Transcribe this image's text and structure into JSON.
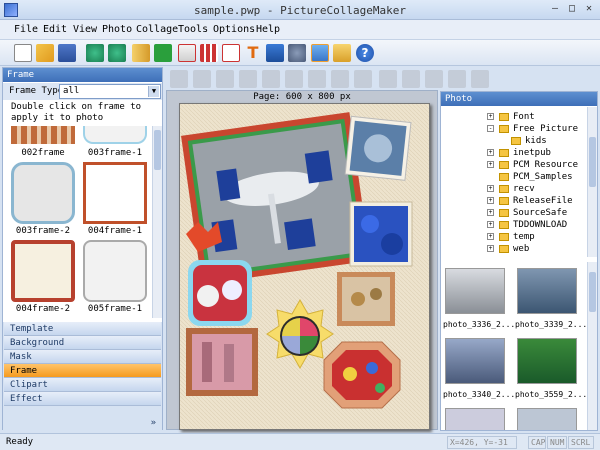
{
  "window": {
    "title": "sample.pwp - PictureCollageMaker"
  },
  "menu": [
    "File",
    "Edit",
    "View",
    "Photo",
    "Collage",
    "Tools",
    "Options",
    "Help"
  ],
  "toolbar_icons": [
    "new-icon",
    "open-icon",
    "save-icon",
    "undo-icon",
    "redo-icon",
    "book-icon",
    "check-icon",
    "layout-icon",
    "grid-icon",
    "text-icon",
    "monitor-icon",
    "settings-icon",
    "image-icon",
    "folder-icon",
    "help-icon"
  ],
  "frame_panel": {
    "header": "Frame",
    "frame_type_label": "Frame Type",
    "frame_type_value": "all",
    "hint": "Double click on frame to apply it to photo",
    "thumbs": [
      {
        "label": "002frame"
      },
      {
        "label": "003frame-1"
      },
      {
        "label": "003frame-2"
      },
      {
        "label": "004frame-1"
      },
      {
        "label": "004frame-2"
      },
      {
        "label": "005frame-1"
      }
    ]
  },
  "accordion": [
    "Template",
    "Background",
    "Mask",
    "Frame",
    "Clipart",
    "Effect"
  ],
  "accordion_active": "Frame",
  "canvas": {
    "page_label": "Page: 600 x 800 px"
  },
  "photo_panel": {
    "header": "Photo",
    "tree": [
      {
        "label": "Font",
        "indent": 0,
        "expander": "+"
      },
      {
        "label": "Free Picture",
        "indent": 0,
        "expander": "-"
      },
      {
        "label": "kids",
        "indent": 1,
        "expander": ""
      },
      {
        "label": "inetpub",
        "indent": 0,
        "expander": "+"
      },
      {
        "label": "PCM Resource",
        "indent": 0,
        "expander": "+"
      },
      {
        "label": "PCM_Samples",
        "indent": 0,
        "expander": ""
      },
      {
        "label": "recv",
        "indent": 0,
        "expander": "+"
      },
      {
        "label": "ReleaseFile",
        "indent": 0,
        "expander": "+"
      },
      {
        "label": "SourceSafe",
        "indent": 0,
        "expander": "+"
      },
      {
        "label": "TDDOWNLOAD",
        "indent": 0,
        "expander": "+"
      },
      {
        "label": "temp",
        "indent": 0,
        "expander": "+"
      },
      {
        "label": "web",
        "indent": 0,
        "expander": "+"
      }
    ],
    "photos": [
      {
        "label": "photo_3336_2..."
      },
      {
        "label": "photo_3339_2..."
      },
      {
        "label": "photo_3340_2..."
      },
      {
        "label": "photo_3559_2..."
      }
    ]
  },
  "status": {
    "text": "Ready",
    "coords": "X=426, Y=-31",
    "cap": "CAP",
    "num": "NUM",
    "scrl": "SCRL"
  }
}
